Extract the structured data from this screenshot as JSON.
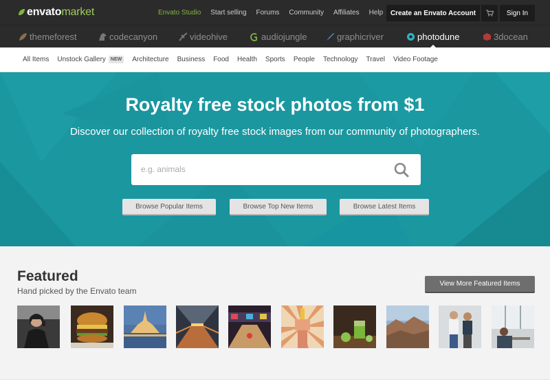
{
  "header": {
    "logo_brand": "envato",
    "logo_market": "market",
    "links": [
      "Envato Studio",
      "Start selling",
      "Forums",
      "Community",
      "Affiliates",
      "Help"
    ],
    "create_account": "Create an Envato Account",
    "sign_in": "Sign In",
    "accent_color": "#82b440"
  },
  "sites": [
    {
      "name": "themeforest",
      "icon": "leaf-icon"
    },
    {
      "name": "codecanyon",
      "icon": "bird-icon"
    },
    {
      "name": "videohive",
      "icon": "bee-icon"
    },
    {
      "name": "audiojungle",
      "icon": "wave-icon"
    },
    {
      "name": "graphicriver",
      "icon": "brush-icon"
    },
    {
      "name": "photodune",
      "icon": "camera-icon",
      "active": true
    },
    {
      "name": "3docean",
      "icon": "cube-icon"
    }
  ],
  "categories": [
    {
      "label": "All Items"
    },
    {
      "label": "Unstock Gallery",
      "badge": "NEW"
    },
    {
      "label": "Architecture"
    },
    {
      "label": "Business"
    },
    {
      "label": "Food"
    },
    {
      "label": "Health"
    },
    {
      "label": "Sports"
    },
    {
      "label": "People"
    },
    {
      "label": "Technology"
    },
    {
      "label": "Travel"
    },
    {
      "label": "Video Footage"
    }
  ],
  "hero": {
    "title": "Royalty free stock photos from $1",
    "subtitle": "Discover our collection of royalty free stock images from our community of photographers.",
    "search_placeholder": "e.g. animals",
    "buttons": [
      "Browse Popular Items",
      "Browse Top New Items",
      "Browse Latest Items"
    ],
    "bg_color": "#1b97a0"
  },
  "featured": {
    "title": "Featured",
    "subtitle": "Hand picked by the Envato team",
    "view_more": "View More Featured Items",
    "thumbnails": [
      {
        "subject": "woman-on-phone"
      },
      {
        "subject": "burger"
      },
      {
        "subject": "mont-saint-michel"
      },
      {
        "subject": "train-station"
      },
      {
        "subject": "bowling-alley"
      },
      {
        "subject": "fist-with-pencil"
      },
      {
        "subject": "green-smoothie"
      },
      {
        "subject": "desert-landscape"
      },
      {
        "subject": "two-men"
      },
      {
        "subject": "woman-at-window"
      }
    ]
  }
}
